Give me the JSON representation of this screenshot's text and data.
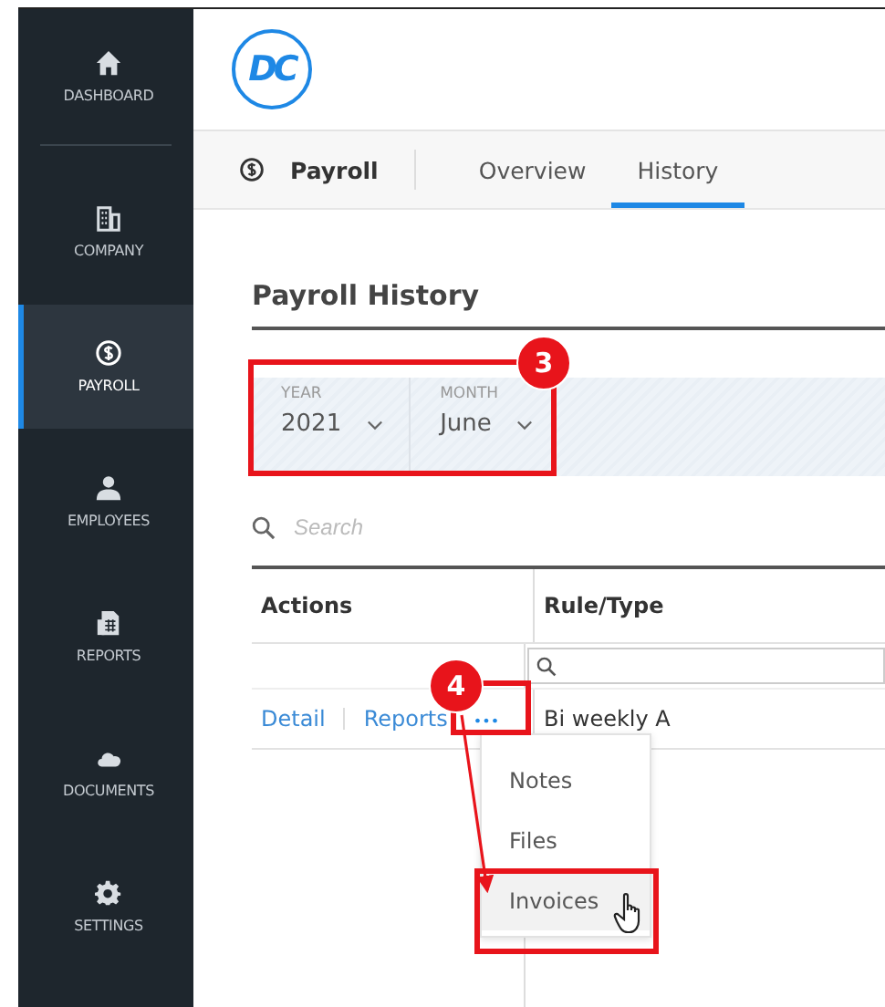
{
  "sidebar": {
    "items": [
      {
        "label": "DASHBOARD",
        "kind": "home",
        "selected": false
      },
      {
        "label": "COMPANY",
        "kind": "building",
        "selected": false
      },
      {
        "label": "PAYROLL",
        "kind": "dollar",
        "selected": true
      },
      {
        "label": "EMPLOYEES",
        "kind": "person",
        "selected": false
      },
      {
        "label": "REPORTS",
        "kind": "report",
        "selected": false
      },
      {
        "label": "DOCUMENTS",
        "kind": "cloud",
        "selected": false
      },
      {
        "label": "SETTINGS",
        "kind": "gear",
        "selected": false
      }
    ]
  },
  "header": {
    "logo": "DC"
  },
  "tabs": {
    "section": "Payroll",
    "items": [
      {
        "label": "Overview",
        "selected": false
      },
      {
        "label": "History",
        "selected": true
      }
    ]
  },
  "page_title": "Payroll History",
  "filters": [
    {
      "label": "YEAR",
      "value": "2021"
    },
    {
      "label": "MONTH",
      "value": "June"
    }
  ],
  "search": {
    "placeholder": "Search"
  },
  "table": {
    "columns": [
      "Actions",
      "Rule/Type"
    ],
    "rows": [
      {
        "actions": [
          "Detail",
          "Reports"
        ],
        "more": "•••",
        "rule_type": "Bi weekly A"
      }
    ]
  },
  "menu": {
    "items": [
      {
        "label": "Notes",
        "hovered": false
      },
      {
        "label": "Files",
        "hovered": false
      },
      {
        "label": "Invoices",
        "hovered": true
      }
    ]
  },
  "annotations": [
    {
      "number": "3"
    },
    {
      "number": "4"
    }
  ]
}
